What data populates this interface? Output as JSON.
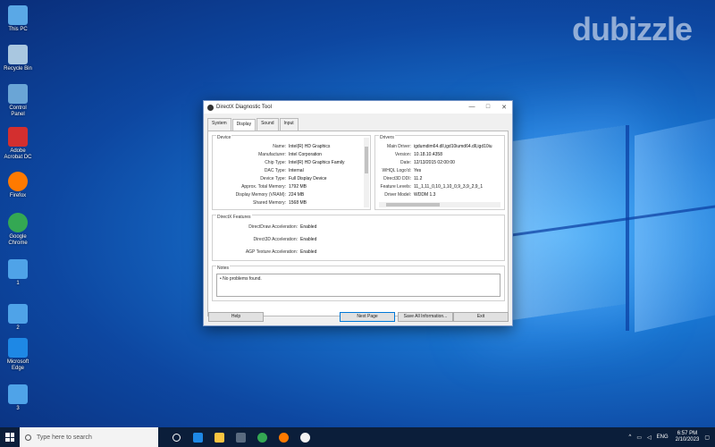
{
  "watermark": "dubizzle",
  "desktop_icons": [
    {
      "label": "This PC",
      "icon": "computer-icon",
      "color": "#5aa8e6"
    },
    {
      "label": "Recycle Bin",
      "icon": "recycle-bin-icon",
      "color": "#a9c7e0"
    },
    {
      "label": "Control Panel",
      "icon": "control-panel-icon",
      "color": "#6aa5d6"
    },
    {
      "label": "Adobe Acrobat DC",
      "icon": "acrobat-icon",
      "color": "#d32f2f"
    },
    {
      "label": "Firefox",
      "icon": "firefox-icon",
      "color": "#ff7a00"
    },
    {
      "label": "Google Chrome",
      "icon": "chrome-icon",
      "color": "#34a853"
    },
    {
      "label": "1",
      "icon": "monitor-icon",
      "color": "#4fa3e8"
    },
    {
      "label": "2",
      "icon": "monitor-icon",
      "color": "#4fa3e8"
    },
    {
      "label": "Microsoft Edge",
      "icon": "edge-icon",
      "color": "#1e88e5"
    },
    {
      "label": "3",
      "icon": "monitor-icon",
      "color": "#4fa3e8"
    }
  ],
  "dialog": {
    "title": "DirectX Diagnostic Tool",
    "controls": [
      "—",
      "□",
      "✕"
    ],
    "tabs": [
      "System",
      "Display",
      "Sound",
      "Input"
    ],
    "active_tab": "Display",
    "device": {
      "title": "Device",
      "rows": [
        {
          "k": "Name:",
          "v": "Intel(R) HD Graphics"
        },
        {
          "k": "Manufacturer:",
          "v": "Intel Corporation"
        },
        {
          "k": "Chip Type:",
          "v": "Intel(R) HD Graphics Family"
        },
        {
          "k": "DAC Type:",
          "v": "Internal"
        },
        {
          "k": "Device Type:",
          "v": "Full Display Device"
        },
        {
          "k": "Approx. Total Memory:",
          "v": "1792 MB"
        },
        {
          "k": "Display Memory (VRAM):",
          "v": "224 MB"
        },
        {
          "k": "Shared Memory:",
          "v": "1568 MB"
        }
      ]
    },
    "drivers": {
      "title": "Drivers",
      "rows": [
        {
          "k": "Main Driver:",
          "v": "igdumdim64.dll,igd10iumd64.dll,igd10iu"
        },
        {
          "k": "Version:",
          "v": "10.18.10.4358"
        },
        {
          "k": "Date:",
          "v": "12/13/2015 02:00:00"
        },
        {
          "k": "WHQL Logo'd:",
          "v": "Yes"
        },
        {
          "k": "Direct3D DDI:",
          "v": "11.2"
        },
        {
          "k": "Feature Levels:",
          "v": "11_1,11_0,10_1,10_0,9_3,9_2,9_1"
        },
        {
          "k": "Driver Model:",
          "v": "WDDM 1.3"
        }
      ]
    },
    "features": {
      "title": "DirectX Features",
      "rows": [
        {
          "k": "DirectDraw Acceleration:",
          "v": "Enabled"
        },
        {
          "k": "Direct3D Acceleration:",
          "v": "Enabled"
        },
        {
          "k": "AGP Texture Acceleration:",
          "v": "Enabled"
        }
      ]
    },
    "notes": {
      "title": "Notes",
      "text": "No problems found."
    },
    "buttons": {
      "help": "Help",
      "next": "Next Page",
      "save": "Save All Information...",
      "exit": "Exit"
    }
  },
  "taskbar": {
    "search_placeholder": "Type here to search",
    "apps": [
      {
        "icon": "task-view-icon",
        "color": "#ffffff"
      },
      {
        "icon": "edge-icon",
        "color": "#1e88e5"
      },
      {
        "icon": "file-explorer-icon",
        "color": "#f9c440"
      },
      {
        "icon": "store-icon",
        "color": "#5a6b80"
      },
      {
        "icon": "chrome-icon",
        "color": "#34a853"
      },
      {
        "icon": "firefox-icon",
        "color": "#ff7a00"
      },
      {
        "icon": "directx-icon",
        "color": "#f2f2f2"
      }
    ],
    "lang": "ENG",
    "time": "6:57 PM",
    "date": "2/10/2023"
  }
}
